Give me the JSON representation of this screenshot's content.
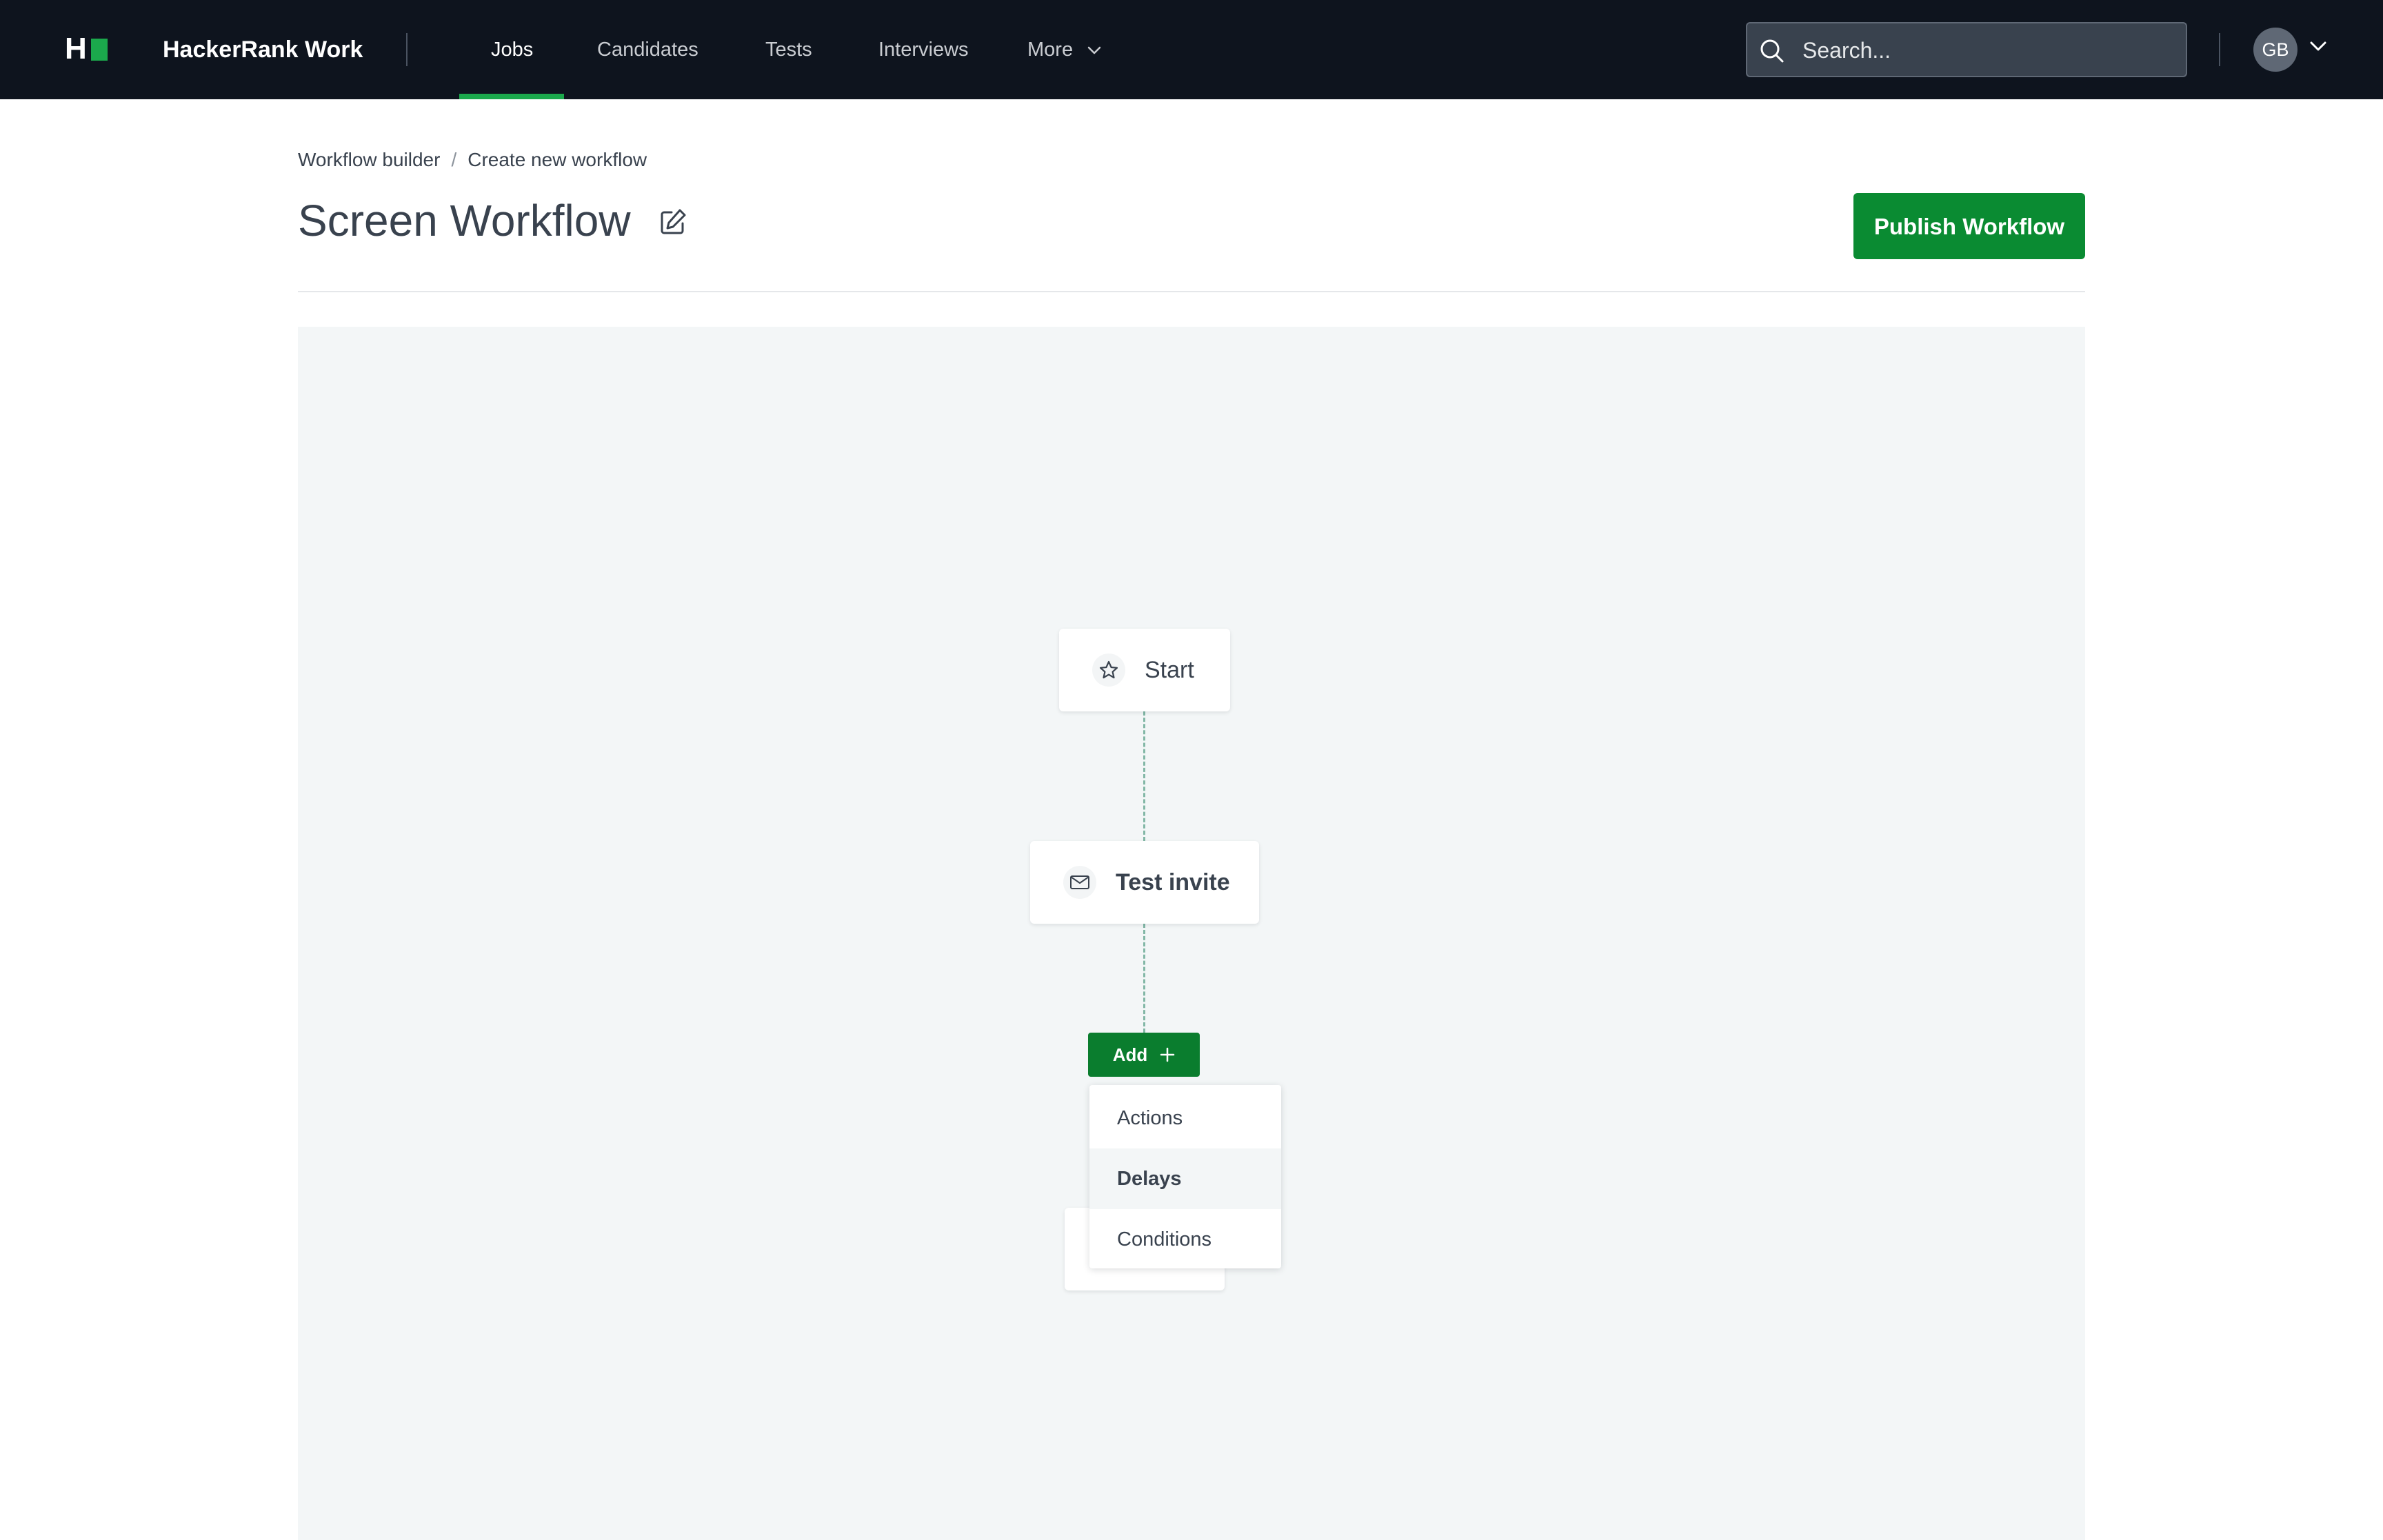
{
  "app": {
    "brand": "HackerRank Work",
    "logo_letter": "H",
    "accent_color": "#1ba94c",
    "nav_bg": "#0e141e"
  },
  "nav": {
    "items": [
      {
        "label": "Jobs",
        "active": true
      },
      {
        "label": "Candidates",
        "active": false
      },
      {
        "label": "Tests",
        "active": false
      },
      {
        "label": "Interviews",
        "active": false
      },
      {
        "label": "More",
        "active": false
      }
    ],
    "search_placeholder": "Search...",
    "avatar_initials": "GB"
  },
  "header": {
    "breadcrumb": [
      "Workflow builder",
      "Create new workflow"
    ],
    "breadcrumb_separator": "/",
    "title": "Screen Workflow",
    "publish_label": "Publish Workflow",
    "publish_color": "#0a8b32"
  },
  "workflow": {
    "nodes": [
      {
        "label": "Start",
        "icon": "star-icon"
      },
      {
        "label": "Test invite",
        "icon": "mail-icon"
      }
    ],
    "add_label": "Add",
    "add_menu": {
      "options": [
        "Actions",
        "Delays",
        "Conditions"
      ],
      "highlighted": "Delays"
    }
  }
}
